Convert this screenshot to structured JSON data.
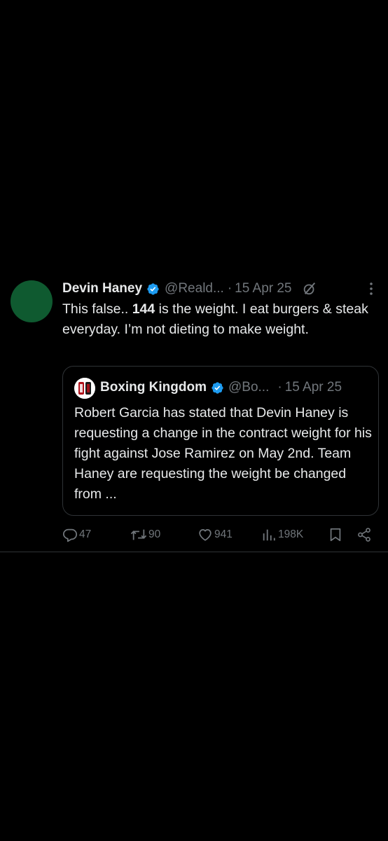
{
  "tweet": {
    "author_name": "Devin Haney",
    "handle": "@Reald...",
    "separator": "·",
    "date": "15 Apr 25",
    "text_before": "This false.. ",
    "text_bold": "144",
    "text_after": " is the weight. I eat burgers & steak everyday. I’m not dieting to make weight.",
    "avatar_color": "#0f5a30"
  },
  "quote": {
    "author_name": "Boxing Kingdom",
    "handle": "@Bo...",
    "separator": "·",
    "date": "15 Apr 25",
    "text": "Robert Garcia has stated that Devin Haney is requesting a change in the contract weight for his fight against Jose Ramirez on May 2nd. Team Haney are requesting the weight be changed from ..."
  },
  "actions": {
    "replies": "47",
    "retweets": "90",
    "likes": "941",
    "views": "198K"
  },
  "colors": {
    "background": "#000000",
    "text": "#e7e9ea",
    "muted": "#71767b",
    "verified": "#1d9bf0",
    "border": "#2f3336"
  },
  "icons": [
    "verified-badge-icon",
    "grok-icon",
    "more-icon",
    "reply-icon",
    "retweet-icon",
    "like-icon",
    "views-icon",
    "bookmark-icon",
    "share-icon"
  ]
}
